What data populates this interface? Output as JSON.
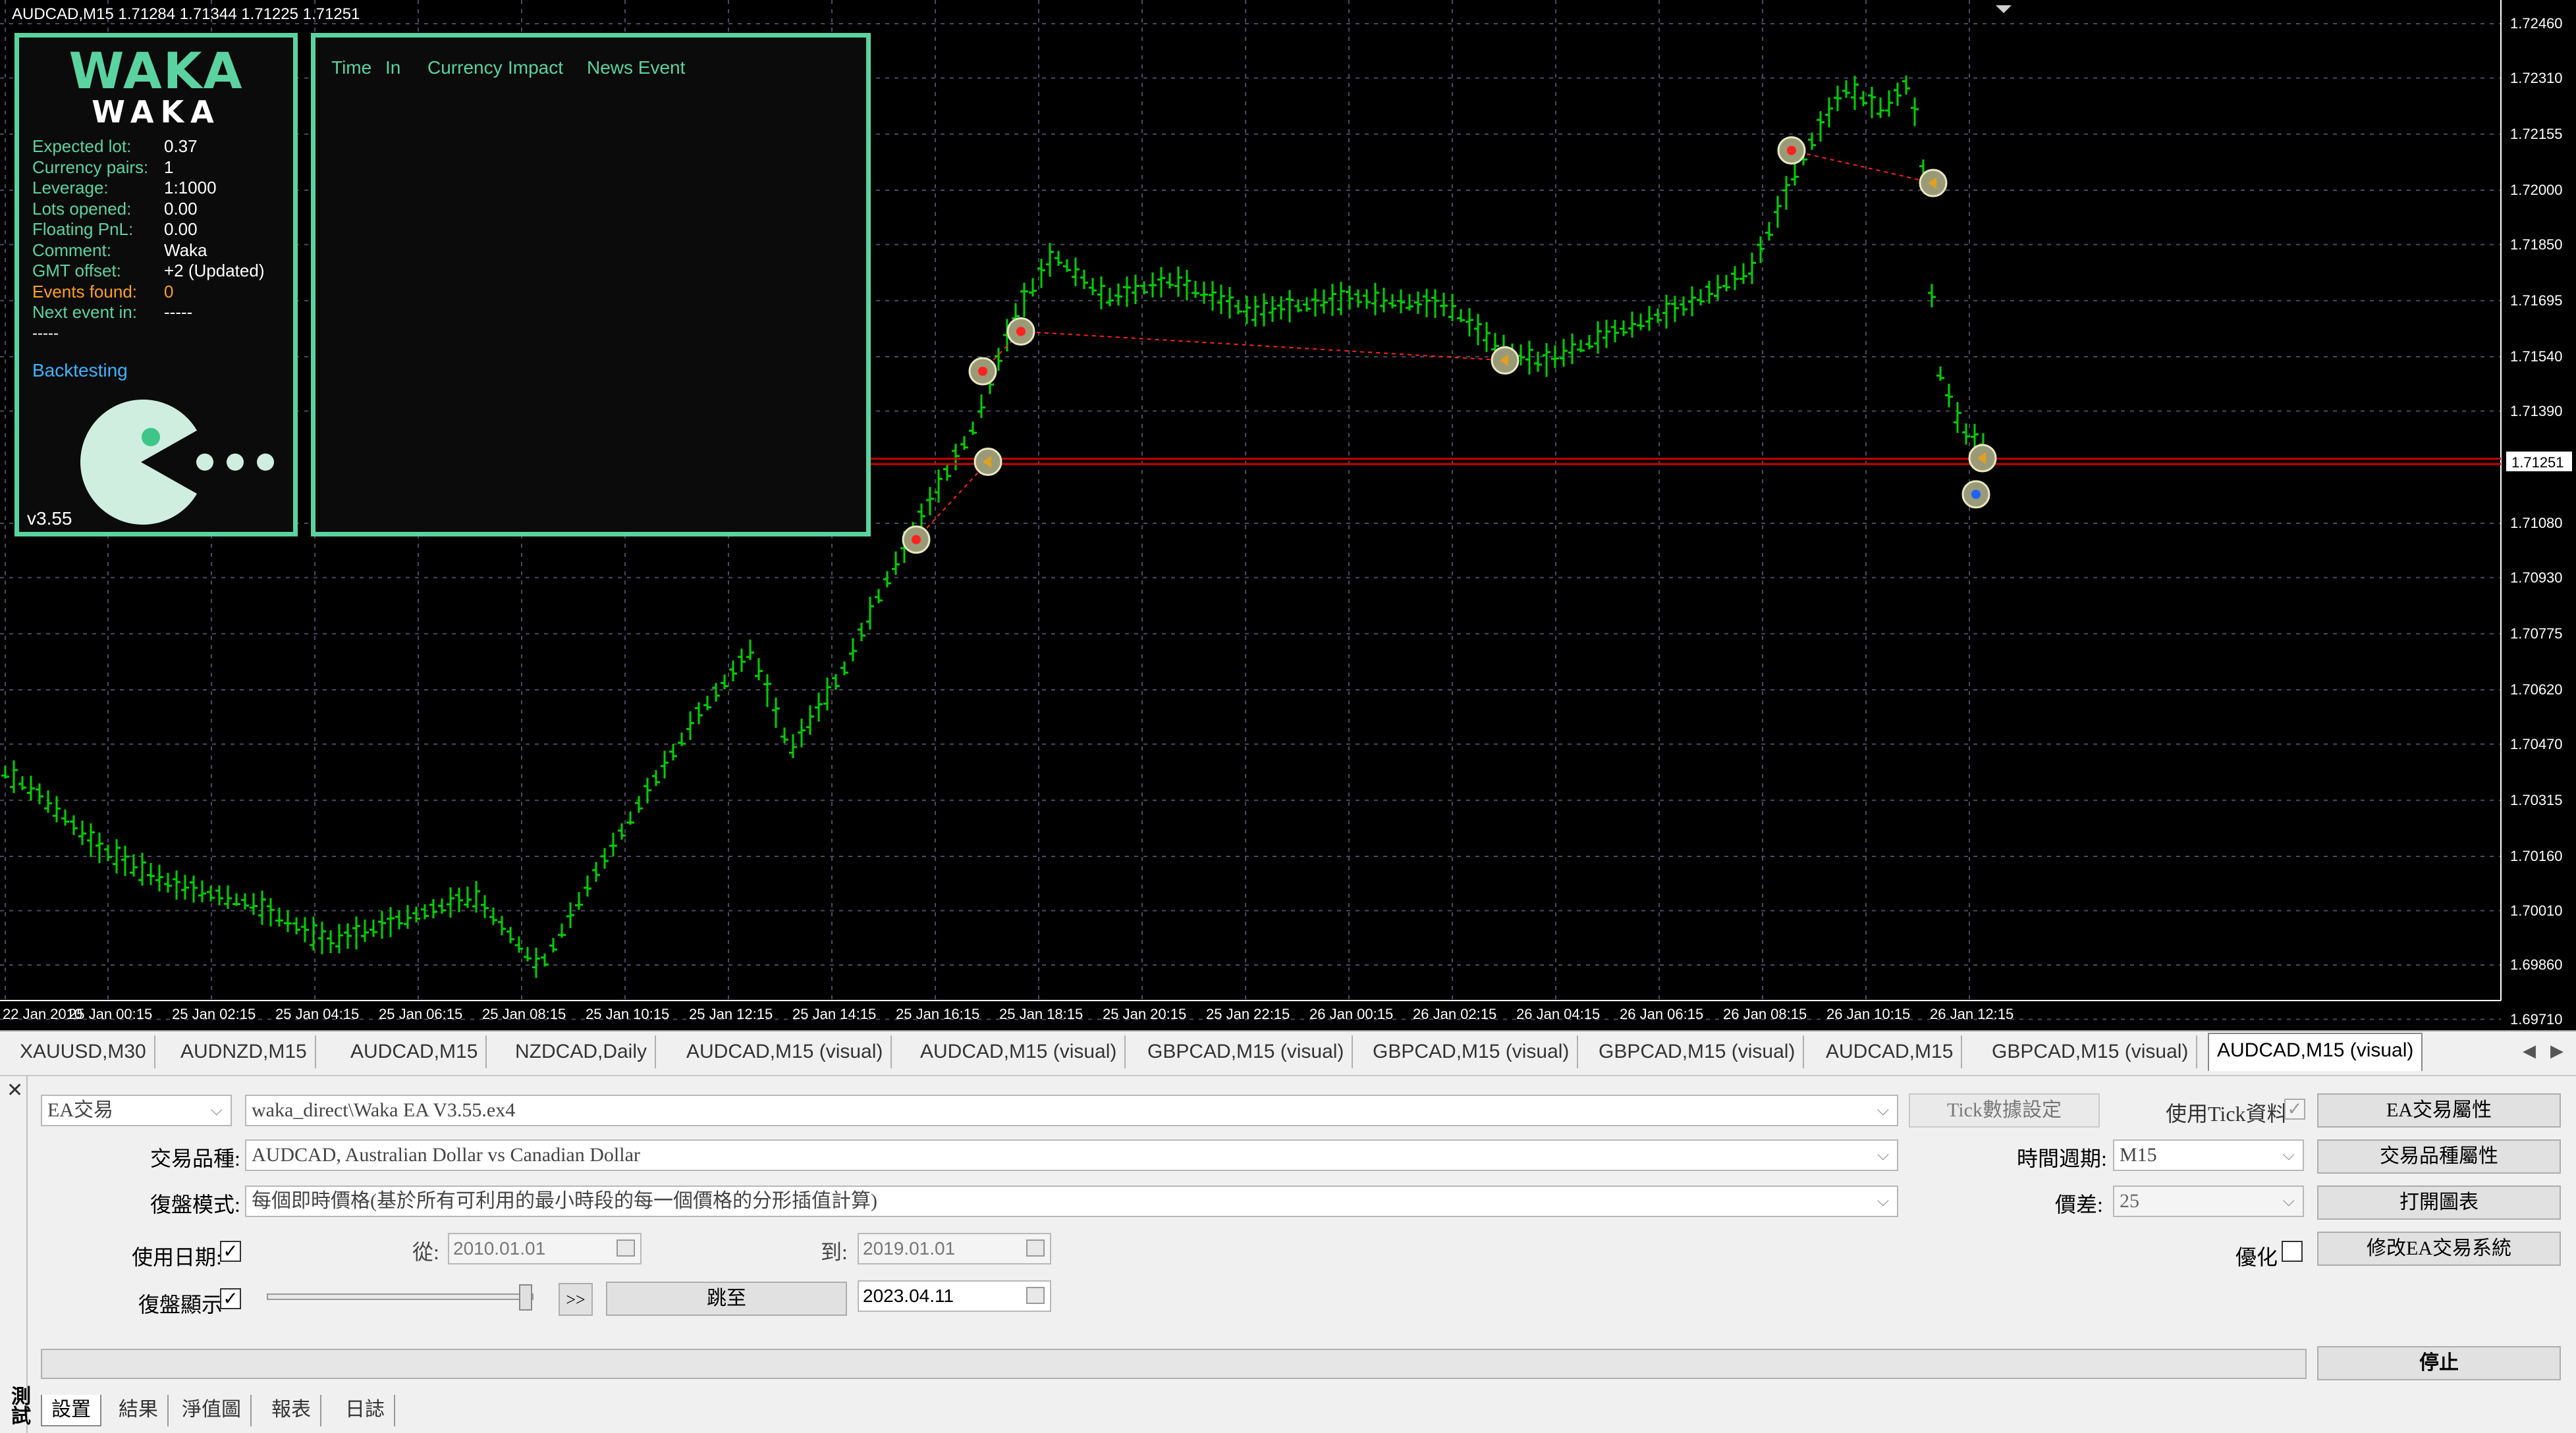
{
  "chart": {
    "header": "AUDCAD,M15  1.71284 1.71344 1.71225 1.71251",
    "current_price": "1.71251",
    "price_levels": [
      "1.72460",
      "1.72310",
      "1.72155",
      "1.72000",
      "1.71850",
      "1.71695",
      "1.71540",
      "1.71390",
      "1.71080",
      "1.70930",
      "1.70775",
      "1.70620",
      "1.70470",
      "1.70315",
      "1.70160",
      "1.70010",
      "1.69860",
      "1.69710"
    ],
    "time_labels": [
      "22 Jan 2010",
      "25 Jan 00:15",
      "25 Jan 02:15",
      "25 Jan 04:15",
      "25 Jan 06:15",
      "25 Jan 08:15",
      "25 Jan 10:15",
      "25 Jan 12:15",
      "25 Jan 14:15",
      "25 Jan 16:15",
      "25 Jan 18:15",
      "25 Jan 20:15",
      "25 Jan 22:15",
      "26 Jan 00:15",
      "26 Jan 02:15",
      "26 Jan 04:15",
      "26 Jan 06:15",
      "26 Jan 08:15",
      "26 Jan 10:15",
      "26 Jan 12:15"
    ],
    "colors": {
      "background": "#000000",
      "candle": "#00d000",
      "grid": "#4a4a66",
      "price_line": "#cc0000",
      "trade_line": "#ff2020",
      "panel_border": "#5ad3a0"
    }
  },
  "waka": {
    "logo": "WAKA",
    "subtitle": "WAKA",
    "rows": [
      {
        "key": "Expected lot:",
        "value": "0.37"
      },
      {
        "key": "Currency pairs:",
        "value": "1"
      },
      {
        "key": "Leverage:",
        "value": "1:1000"
      },
      {
        "key": "Lots opened:",
        "value": "0.00"
      },
      {
        "key": "Floating PnL:",
        "value": "0.00"
      },
      {
        "key": "Comment:",
        "value": "Waka"
      },
      {
        "key": "GMT offset:",
        "value": "+2 (Updated)"
      },
      {
        "key": "Events found:",
        "value": "0"
      },
      {
        "key": "Next event in:",
        "value": "-----"
      }
    ],
    "dashes": "-----",
    "status": "Backtesting",
    "version": "v3.55"
  },
  "news": {
    "columns": [
      "Time",
      "In",
      "Currency",
      "Impact",
      "News Event"
    ]
  },
  "symbol_tabs": [
    "XAUUSD,M30",
    "AUDNZD,M15",
    "AUDCAD,M15",
    "NZDCAD,Daily",
    "AUDCAD,M15 (visual)",
    "AUDCAD,M15 (visual)",
    "GBPCAD,M15 (visual)",
    "GBPCAD,M15 (visual)",
    "GBPCAD,M15 (visual)",
    "AUDCAD,M15",
    "GBPCAD,M15 (visual)",
    "AUDCAD,M15 (visual)"
  ],
  "tester": {
    "vertical_label": "測試",
    "mode_select": "EA交易",
    "expert_file": "waka_direct\\Waka EA V3.55.ex4",
    "tick_settings_btn": "Tick數據設定",
    "use_tick_label": "使用Tick資料",
    "ea_props_btn": "EA交易屬性",
    "symbol_label": "交易品種:",
    "symbol_value": "AUDCAD, Australian Dollar vs Canadian Dollar",
    "period_label": "時間週期:",
    "period_value": "M15",
    "symbol_props_btn": "交易品種屬性",
    "model_label": "復盤模式:",
    "model_value": "每個即時價格(基於所有可利用的最小時段的每一個價格的分形插值計算)",
    "spread_label": "價差:",
    "spread_value": "25",
    "open_chart_btn": "打開圖表",
    "use_date_label": "使用日期:",
    "from_label": "從:",
    "from_value": "2010.01.01",
    "to_label": "到:",
    "to_value": "2019.01.01",
    "optimize_label": "優化",
    "modify_expert_btn": "修改EA交易系統",
    "visual_label": "復盤顯示",
    "skip_btn": ">>",
    "jump_btn": "跳至",
    "jump_date": "2023.04.11",
    "stop_btn": "停止",
    "bottom_tabs": [
      "設置",
      "結果",
      "淨值圖",
      "報表",
      "日誌"
    ]
  }
}
